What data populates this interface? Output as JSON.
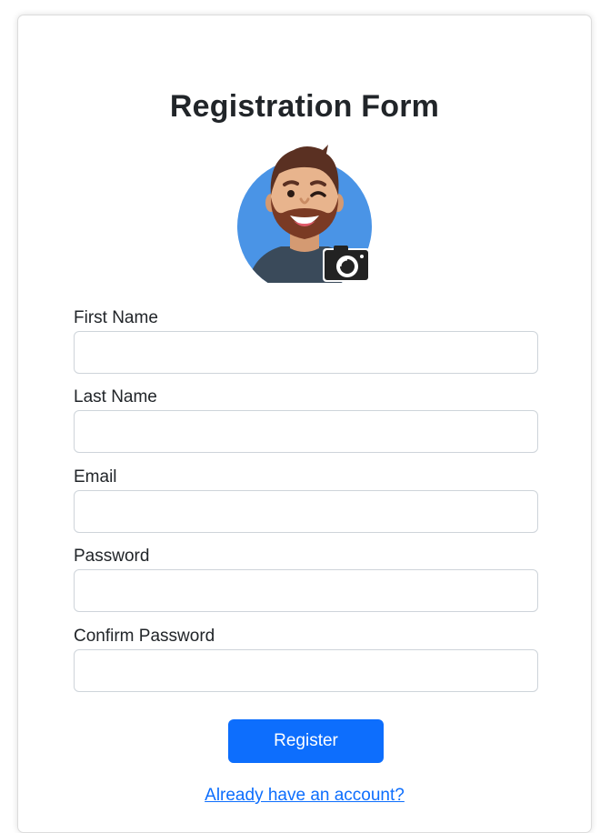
{
  "form": {
    "title": "Registration Form",
    "fields": [
      {
        "label": "First Name",
        "value": "",
        "placeholder": ""
      },
      {
        "label": "Last Name",
        "value": "",
        "placeholder": ""
      },
      {
        "label": "Email",
        "value": "",
        "placeholder": ""
      },
      {
        "label": "Password",
        "value": "",
        "placeholder": ""
      },
      {
        "label": "Confirm Password",
        "value": "",
        "placeholder": ""
      }
    ],
    "register_label": "Register",
    "login_link": "Already have an account?"
  },
  "avatar": {
    "image": "avatar-illustration",
    "badge_icon": "camera-icon"
  },
  "colors": {
    "accent": "#0d6efd",
    "avatar_bg": "#4a94e6",
    "camera": "#222222"
  }
}
